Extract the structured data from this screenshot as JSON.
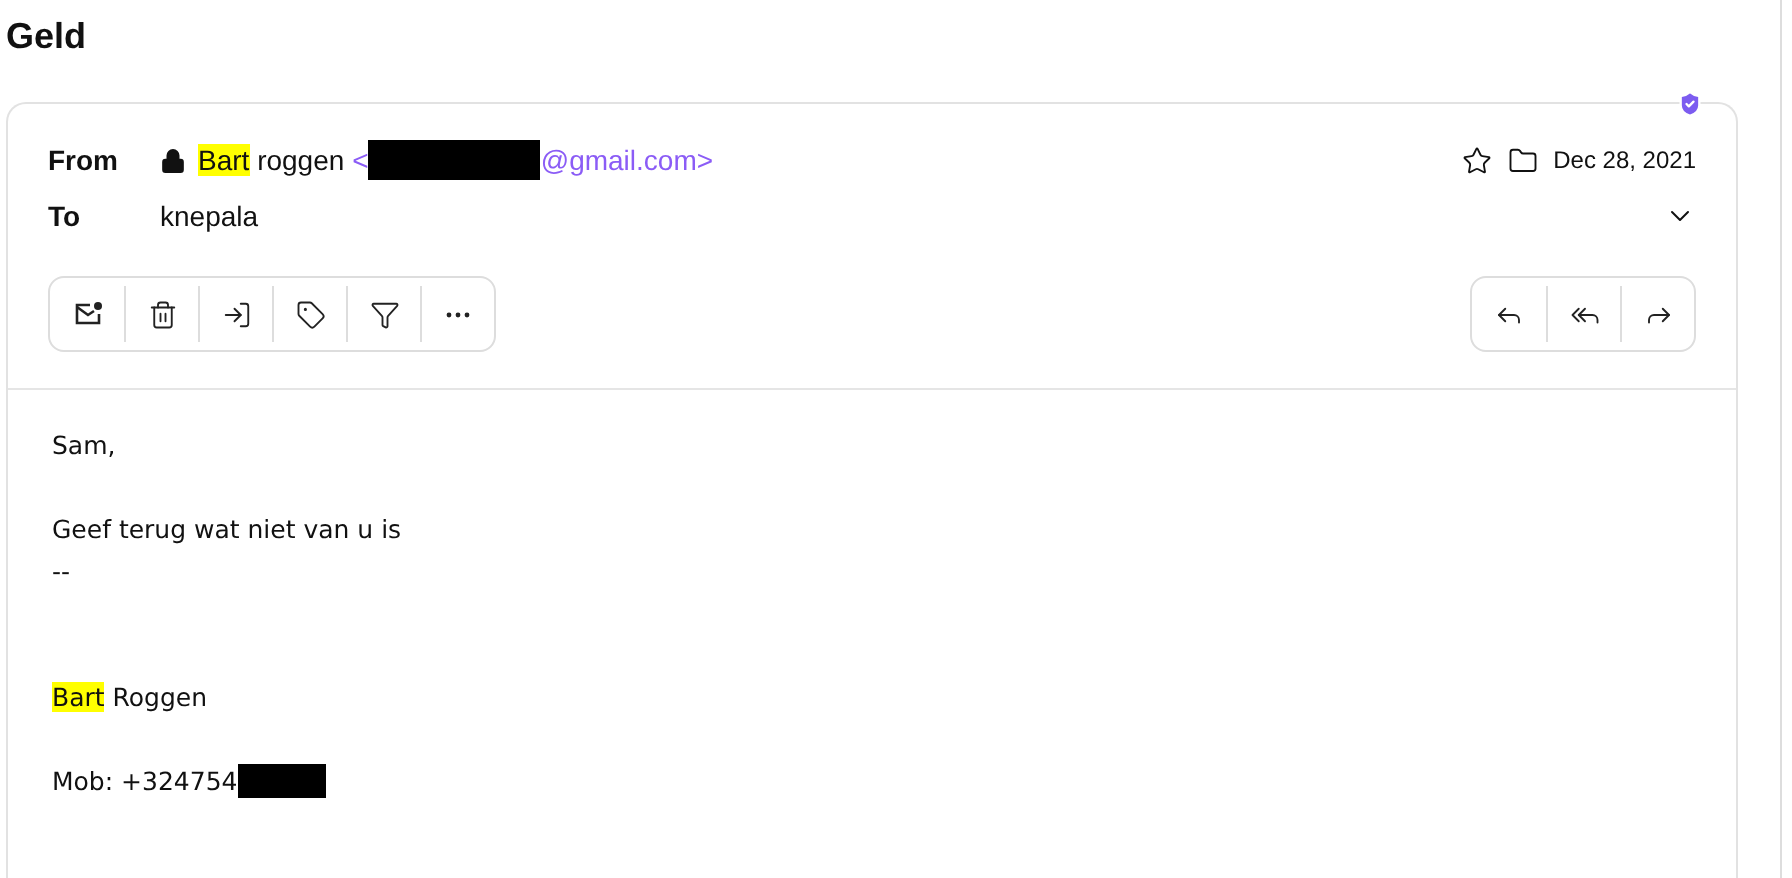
{
  "title": "Geld",
  "header": {
    "verified": true,
    "from_label": "From",
    "locked": true,
    "sender": [
      {
        "text": "Bart",
        "highlighted": true
      },
      {
        "text": " roggen",
        "highlighted": false
      }
    ],
    "address_prefix": "<",
    "address_redacted": true,
    "address_suffix": "@gmail.com>",
    "date": "Dec 28, 2021",
    "to_label": "To",
    "recipient": "knepala"
  },
  "body": [
    {
      "kind": "text",
      "segments": [
        {
          "text": "Sam,",
          "highlighted": false
        }
      ]
    },
    {
      "kind": "gap"
    },
    {
      "kind": "text",
      "segments": [
        {
          "text": "Geef terug wat niet van u is",
          "highlighted": false
        }
      ]
    },
    {
      "kind": "text",
      "segments": [
        {
          "text": "--",
          "highlighted": false
        }
      ]
    },
    {
      "kind": "gap"
    },
    {
      "kind": "gap"
    },
    {
      "kind": "text",
      "segments": [
        {
          "text": "Bart",
          "highlighted": true
        },
        {
          "text": " Roggen",
          "highlighted": false
        }
      ]
    },
    {
      "kind": "gap"
    },
    {
      "kind": "text",
      "segments": [
        {
          "text": "Mob: +324754",
          "highlighted": false
        }
      ],
      "redacted": true
    }
  ]
}
